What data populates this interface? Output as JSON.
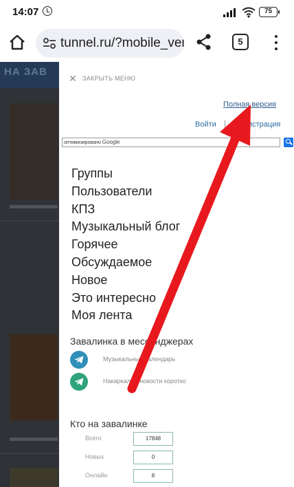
{
  "statusbar": {
    "time": "14:07",
    "battery": "75"
  },
  "browser": {
    "url": "tunnel.ru/?mobile_ver",
    "tab_count": "5"
  },
  "background": {
    "logo": "НА ЗАВ"
  },
  "drawer": {
    "close_label": "ЗАКРЫТЬ МЕНЮ",
    "full_version": "Полная версия",
    "login": "Войти",
    "separator": "|",
    "register": "Регистрация",
    "search_placeholder_prefix": "оптимизировано",
    "search_placeholder_brand": "Google",
    "menu": [
      "Группы",
      "Пользователи",
      "КПЗ",
      "Музыкальный блог",
      "Горячее",
      "Обсуждаемое",
      "Новое",
      "Это интересно",
      "Моя лента"
    ],
    "messengers_title": "Завалинка в мессенджерах",
    "messengers": [
      {
        "label": "Музыкальный календарь",
        "icon": "telegram-icon",
        "color": "#2f8fb8"
      },
      {
        "label": "Накаркали - новости коротко",
        "icon": "telegram-icon",
        "color": "#2fa37a"
      }
    ],
    "online_title": "Кто на завалинке",
    "stats": [
      {
        "label": "Всего",
        "value": "17848"
      },
      {
        "label": "Новых",
        "value": "0"
      },
      {
        "label": "Онлайн",
        "value": "8"
      }
    ]
  },
  "colors": {
    "arrow": "#e8191e",
    "link": "#2b6aa0",
    "overlay": "#2f3236"
  }
}
